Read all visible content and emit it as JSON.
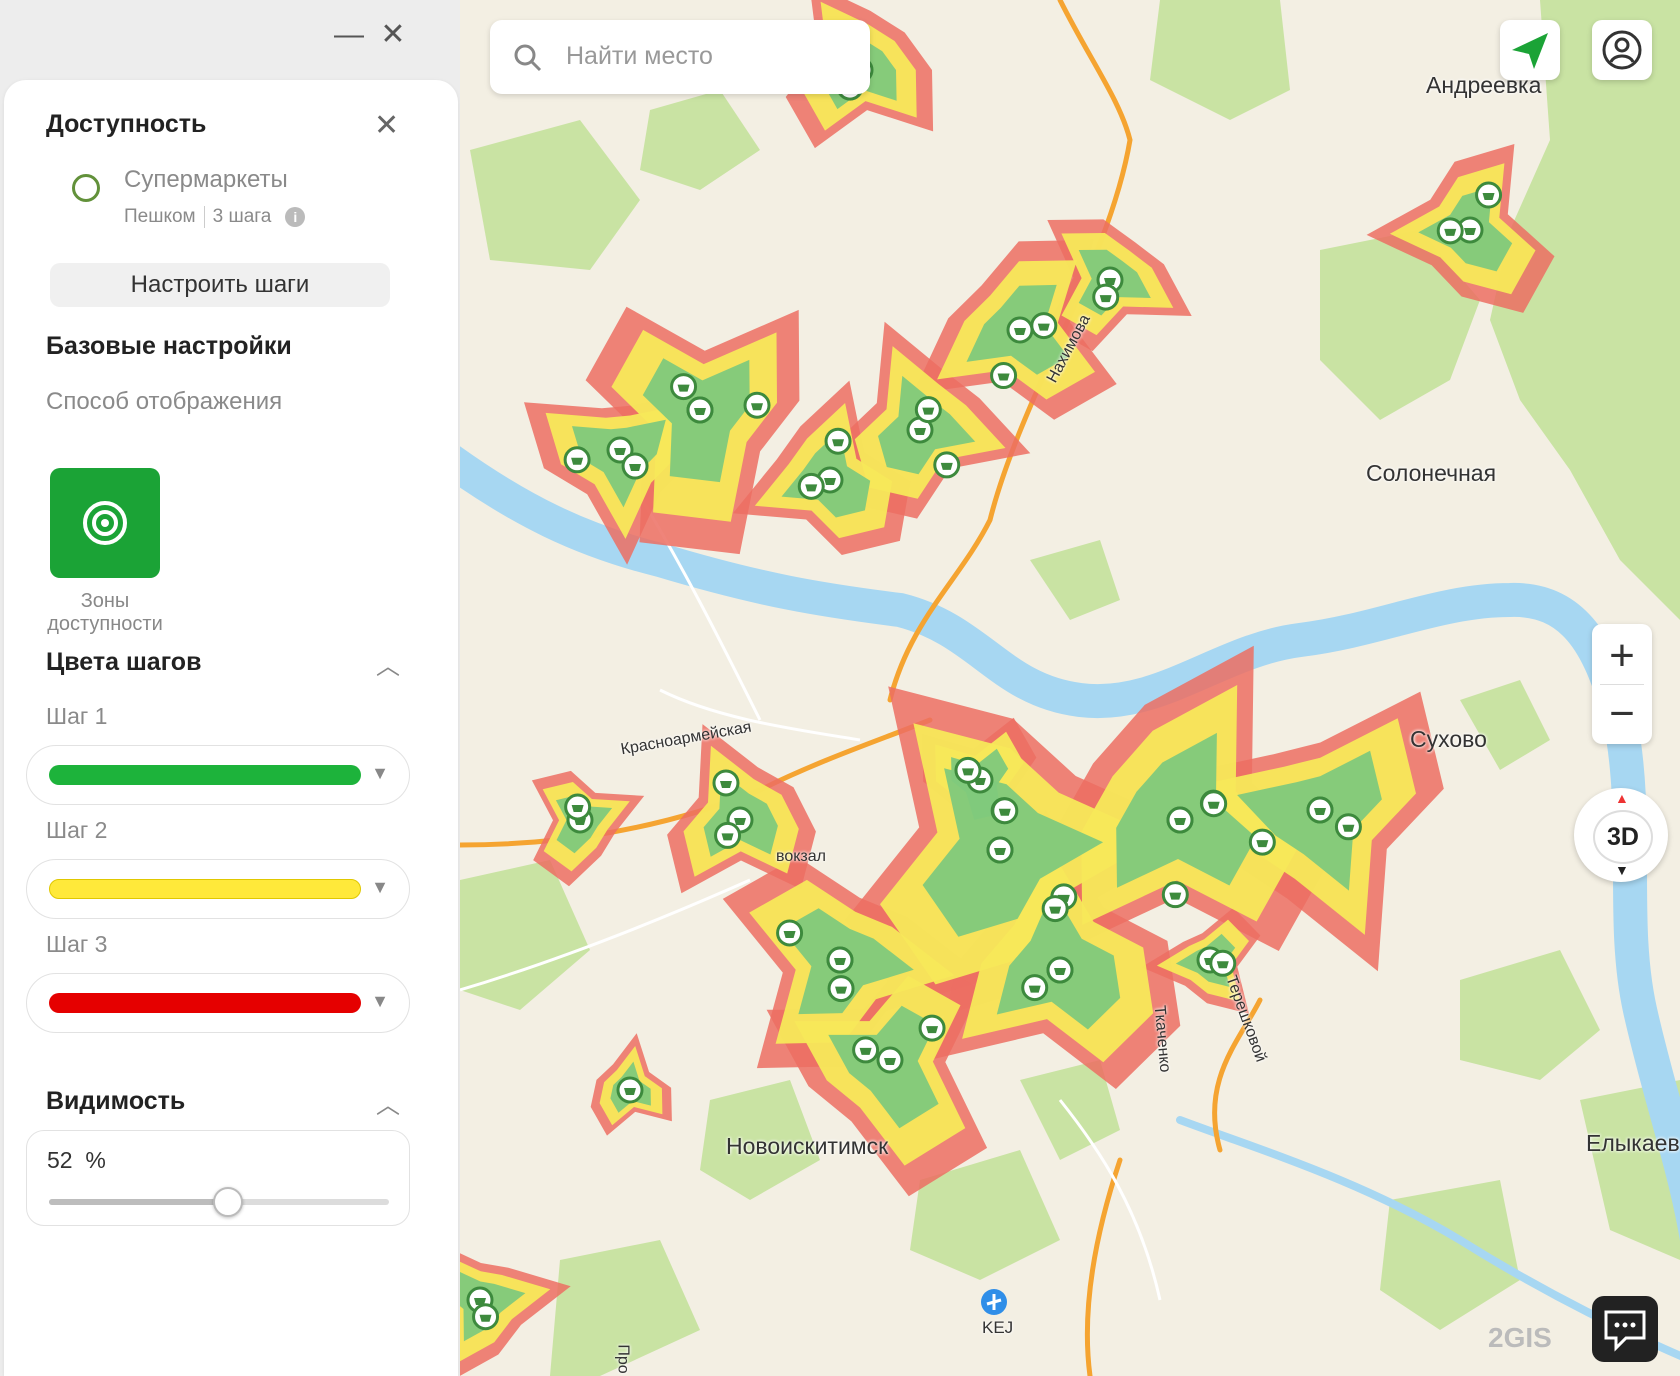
{
  "window": {
    "minimize_glyph": "—",
    "close_glyph": "✕"
  },
  "panel": {
    "title": "Доступность",
    "layer": {
      "name": "Супермаркеты",
      "mode": "Пешком",
      "steps": "3 шага"
    },
    "setup_button": "Настроить шаги",
    "base_settings_title": "Базовые настройки",
    "display_mode_label": "Способ отображения",
    "display_mode_option": "Зоны доступности",
    "step_colors_title": "Цвета шагов",
    "steps": [
      {
        "label": "Шаг 1",
        "color": "#1db33b"
      },
      {
        "label": "Шаг 2",
        "color": "#ffe93a"
      },
      {
        "label": "Шаг 3",
        "color": "#e50000"
      }
    ],
    "visibility": {
      "title": "Видимость",
      "value_text": "52  %",
      "value": 52
    }
  },
  "map": {
    "search_placeholder": "Найти место",
    "places": [
      "Андреевка",
      "Солонечная",
      "Сухово",
      "Елыкаев",
      "Новоискитимск"
    ],
    "streets": [
      "Красноармейская",
      "Нахимова",
      "Терешковой",
      "Ткаченко",
      "Про",
      "вокзал"
    ],
    "airport_code": "KEJ",
    "zoom_in": "+",
    "zoom_out": "−",
    "mode_3d": "3D",
    "brand": "2GIS",
    "zone_colors": {
      "inner": "#7fc97c",
      "middle": "#f7e85a",
      "outer": "#ec6f63"
    }
  }
}
